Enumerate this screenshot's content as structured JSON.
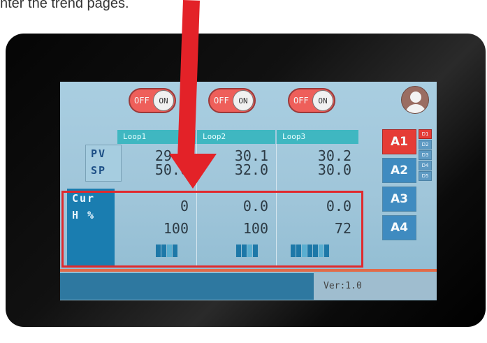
{
  "caption": "nter the trend pages.",
  "toggles": [
    {
      "off_label": "OFF",
      "on_label": "ON"
    },
    {
      "off_label": "OFF",
      "on_label": "ON"
    },
    {
      "off_label": "OFF",
      "on_label": "ON"
    }
  ],
  "loops": [
    {
      "name": "Loop1",
      "pv": "29.8",
      "sp": "50.0",
      "cur": "0",
      "h": "100",
      "bars": 4
    },
    {
      "name": "Loop2",
      "pv": "30.1",
      "sp": "32.0",
      "cur": "0.0",
      "h": "100",
      "bars": 4
    },
    {
      "name": "Loop3",
      "pv": "30.2",
      "sp": "30.0",
      "cur": "0.0",
      "h": "72",
      "bars": 7
    }
  ],
  "row_labels": {
    "pv": "PV",
    "sp": "SP",
    "cur": "Cur",
    "h": "H %"
  },
  "side_buttons": [
    {
      "label": "A1",
      "active": true
    },
    {
      "label": "A2",
      "active": false
    },
    {
      "label": "A3",
      "active": false
    },
    {
      "label": "A4",
      "active": false
    }
  ],
  "d_buttons": [
    "D1",
    "D2",
    "D3",
    "D4",
    "D5"
  ],
  "version": "Ver:1.0",
  "colors": {
    "accent_red": "#e32228",
    "active_tab": "#e53c36",
    "tab_blue": "#3f8bc0",
    "header_teal": "#3fb7c1"
  },
  "icons": {
    "user": "user-avatar-icon"
  }
}
